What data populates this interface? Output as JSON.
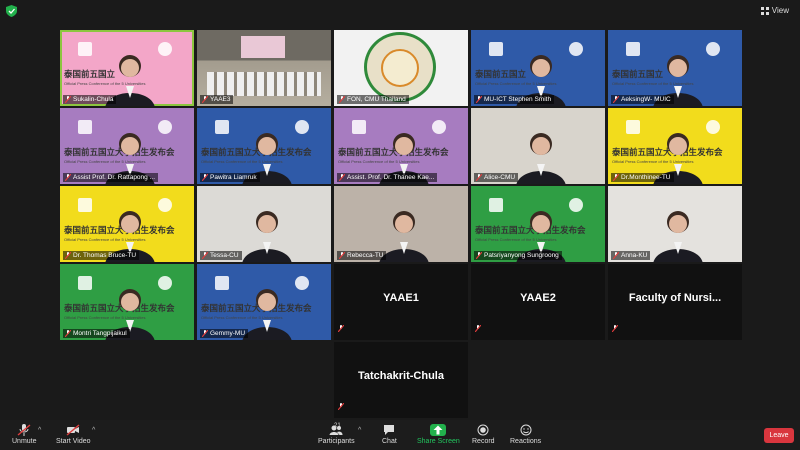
{
  "topbar": {
    "view_label": "View",
    "security_icon": "shield-icon",
    "accent_color": "#22b14c"
  },
  "tiles": [
    {
      "name": "Sukalin-Chula",
      "banner": "泰国前五国立",
      "banner_sub": "Official Press Conference of the 5 Universities",
      "bg": "#f3a6c8",
      "active": true
    },
    {
      "name": "YAAE3",
      "banner": "",
      "banner_sub": "",
      "bg": "#8a8478",
      "active": false
    },
    {
      "name": "FON, CMU Thailand",
      "banner": "",
      "banner_sub": "",
      "bg": "#f2f2f2",
      "active": false
    },
    {
      "name": "MU-ICT Stephen Smith",
      "banner": "泰国前五国立",
      "banner_sub": "Official Press Conference of the 5 Universities",
      "bg": "#2f5aa8",
      "active": false
    },
    {
      "name": "AeksingW- MUIC",
      "banner": "泰国前五国立",
      "banner_sub": "Official Press Conference of the 5 Universities",
      "bg": "#2f5aa8",
      "active": false
    },
    {
      "name": "Assist Prof. Dr. Rattapong ...",
      "banner": "泰国前五国立大学招生发布会",
      "banner_sub": "Official Press Conference of the 5 Universities",
      "bg": "#a77cc0",
      "active": false
    },
    {
      "name": "Pawitra Liamruk",
      "banner": "泰国前五国立大学招生发布会",
      "banner_sub": "Official Press Conference of the 5 Universities",
      "bg": "#2f5aa8",
      "active": false
    },
    {
      "name": "Assist. Prof. Dr. Thanee Kae...",
      "banner": "泰国前五国立大学招生发布会",
      "banner_sub": "Official Press Conference of the 5 Universities",
      "bg": "#a77cc0",
      "active": false
    },
    {
      "name": "Alice-CMU",
      "banner": "",
      "banner_sub": "",
      "bg": "#d8d4cc",
      "active": false
    },
    {
      "name": "Dr.Monthinee-TU",
      "banner": "泰国前五国立大学招生发布会",
      "banner_sub": "Official Press Conference of the 5 Universities",
      "bg": "#f2dc1c",
      "active": false
    },
    {
      "name": "Dr. Thomas Bruce-TU",
      "banner": "泰国前五国立大学招生发布会",
      "banner_sub": "Official Press Conference of the 5 Universities",
      "bg": "#f2dc1c",
      "active": false
    },
    {
      "name": "Tessa-CU",
      "banner": "",
      "banner_sub": "",
      "bg": "#dcdad6",
      "active": false
    },
    {
      "name": "Rebecca-TU",
      "banner": "",
      "banner_sub": "",
      "bg": "#bcb2a8",
      "active": false
    },
    {
      "name": "Patsriyanyong Sungroong",
      "banner": "泰国前五国立大学招生发布会",
      "banner_sub": "Official Press Conference of the 5 Universities",
      "bg": "#2f9e44",
      "active": false
    },
    {
      "name": "Anna-KU",
      "banner": "",
      "banner_sub": "",
      "bg": "#e4e2de",
      "active": false
    },
    {
      "name": "Montri Tangpijaikul",
      "banner": "泰国前五国立大学招生发布会",
      "banner_sub": "Official Press Conference of the 5 Universities",
      "bg": "#2f9e44",
      "active": false
    },
    {
      "name": "Gemmy-MU",
      "banner": "泰国前五国立大学招生发布会",
      "banner_sub": "Official Press Conference of the 5 Universities",
      "bg": "#2f5aa8",
      "active": false
    },
    {
      "name": "YAAE1",
      "big": true
    },
    {
      "name": "YAAE2",
      "big": true
    },
    {
      "name": "Faculty of Nursi...",
      "big": true
    },
    {
      "name": "Tatchakrit-Chula",
      "big": true
    }
  ],
  "toolbar": {
    "unmute": "Unmute",
    "start_video": "Start Video",
    "participants": "Participants",
    "participants_count": "21",
    "chat": "Chat",
    "share_screen": "Share Screen",
    "record": "Record",
    "reactions": "Reactions",
    "leave": "Leave",
    "caret": "^"
  }
}
